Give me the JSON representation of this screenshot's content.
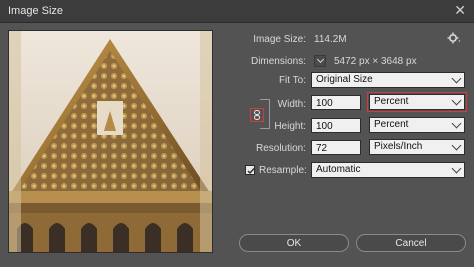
{
  "window": {
    "title": "Image Size",
    "close_icon": "close-icon"
  },
  "info": {
    "image_size_label": "Image Size:",
    "image_size_value": "114.2M",
    "dimensions_label": "Dimensions:",
    "dimensions_value": "5472 px  ×  3648 px",
    "settings_icon": "gear-icon"
  },
  "controls": {
    "fit_to_label": "Fit To:",
    "fit_to_value": "Original Size",
    "width_label": "Width:",
    "width_value": "100",
    "width_unit": "Percent",
    "height_label": "Height:",
    "height_value": "100",
    "height_unit": "Percent",
    "resolution_label": "Resolution:",
    "resolution_value": "72",
    "resolution_unit": "Pixels/Inch",
    "resample_label": "Resample:",
    "resample_checked": true,
    "resample_method": "Automatic"
  },
  "buttons": {
    "ok_label": "OK",
    "cancel_label": "Cancel"
  },
  "colors": {
    "dialog_bg": "#535353",
    "highlight_red": "#d23b3b"
  }
}
